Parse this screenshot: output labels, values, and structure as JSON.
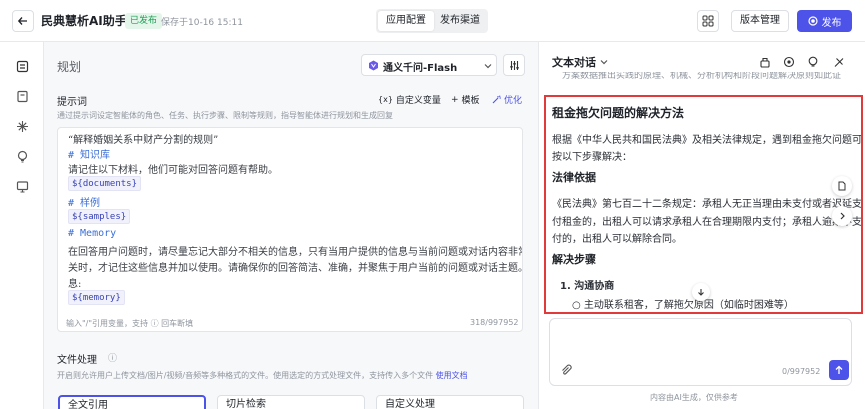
{
  "header": {
    "app_title": "民典慧析AI助手",
    "status_badge": "已发布",
    "saved_time": "保存于10-16 15:11",
    "tabs": [
      {
        "label": "应用配置"
      },
      {
        "label": "发布渠道"
      }
    ],
    "version_button": "版本管理",
    "publish_button": "发布",
    "accent_color": "#4d53e8"
  },
  "rail": {
    "icons": [
      "document-icon",
      "book-icon",
      "puzzle-icon",
      "bulb-icon",
      "monitor-icon"
    ]
  },
  "config": {
    "mode_label": "规划",
    "model": {
      "selected": "通义千问-Flash"
    },
    "prompt": {
      "label": "提示词",
      "description": "通过提示词设定智能体的角色、任务、执行步骤、限制等规则，指导智能体进行规划和生成回复",
      "custom_variable": "自定义变量",
      "template": "模板",
      "optimize": "优化",
      "lines": {
        "l1": "“解释婚姻关系中财产分割的规则”",
        "h_knowledge": "# 知识库",
        "l2": "请记住以下材料，他们可能对回答问题有帮助。",
        "v_documents": "${documents}",
        "h_samples": "# 样例",
        "v_samples": "${samples}",
        "h_memory": "# Memory",
        "l3": "在回答用户问题时，请尽量忘记大部分不相关的信息，只有当用户提供的信息与当前问题或对话内容非常相",
        "l4": "关时，才记住这些信息并加以使用。请确保你的回答简洁、准确，并聚焦于用户当前的问题或对话主题。信",
        "l5": "息:",
        "v_memory": "${memory}"
      },
      "footer_hint": "输入\"/\"引用变量，支持 ⓘ 回车断填",
      "counter": "318/997952"
    },
    "file_processing": {
      "label": "文件处理",
      "description": "开启则允许用户上传文档/图片/视频/音频等多种格式的文件。使用选定的方式处理文件，支持传入多个文件",
      "link": "使用文档",
      "options": [
        {
          "label": "全文引用"
        },
        {
          "label": "切片检索"
        },
        {
          "label": "自定义处理"
        }
      ]
    }
  },
  "chat": {
    "title": "文本对话",
    "cut_text": "方案数据推出实践的原理、机械、分析机构和阶段问题解决原则如此证",
    "answer": {
      "heading": "租金拖欠问题的解决方法",
      "intro_1": "根据《中华人民共和国民法典》及相关法律规定，遇到租金拖欠问题可",
      "intro_2": "按以下步骤解决：",
      "basis_heading": "法律依据",
      "basis_1": "《民法典》第七百二十二条规定：承租人无正当理由未支付或者迟延支",
      "basis_2": "付租金的，出租人可以请求承租人在合理期限内支付；承租人逾期不支",
      "basis_3": "付的，出租人可以解除合同。",
      "steps_heading": "解决步骤",
      "step1": "1. 沟通协商",
      "step1_sub": "主动联系租客，了解拖欠原因（如临时困难等）"
    },
    "input_counter": "0/997952",
    "disclaimer": "内容由AI生成，仅供参考"
  }
}
